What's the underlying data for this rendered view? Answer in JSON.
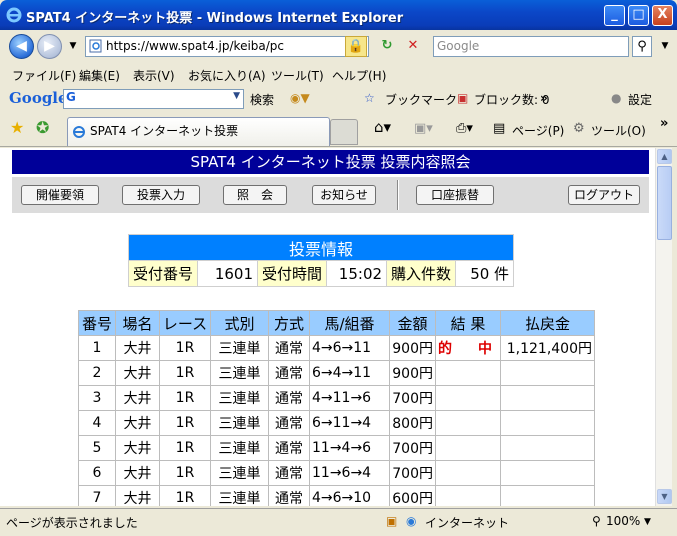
{
  "window": {
    "title": "SPAT4 インターネット投票 - Windows Internet Explorer",
    "minimize": "_",
    "maximize": "□",
    "close": "X"
  },
  "address": {
    "url": "https://www.spat4.jp/keiba/pc",
    "search_placeholder": "Google"
  },
  "menu": [
    "ファイル(F)",
    "編集(E)",
    "表示(V)",
    "お気に入り(A)",
    "ツール(T)",
    "ヘルプ(H)"
  ],
  "google_bar": {
    "logo": "Google",
    "search": "検索",
    "bookmarks": "ブックマーク",
    "blocked": "ブロック数: 0",
    "settings": "設定"
  },
  "tab": {
    "title": "SPAT4 インターネット投票",
    "page": "ページ(P)",
    "tools": "ツール(O)"
  },
  "page": {
    "header": "SPAT4 インターネット投票 投票内容照会",
    "nav": [
      "開催要領",
      "投票入力",
      "照　会",
      "お知らせ",
      "口座振替",
      "ログアウト"
    ],
    "info": {
      "caption": "投票情報",
      "receipt_label": "受付番号",
      "receipt_value": "1601",
      "time_label": "受付時間",
      "time_value": "15:02",
      "count_label": "購入件数",
      "count_value": "50 件"
    },
    "table": {
      "headers": [
        "番号",
        "場名",
        "レース",
        "式別",
        "方式",
        "馬/組番",
        "金額",
        "結 果",
        "払戻金"
      ],
      "rows": [
        [
          "1",
          "大井",
          "1R",
          "三連単",
          "通常",
          "4→6→11",
          "900円",
          "的　中",
          "1,121,400円"
        ],
        [
          "2",
          "大井",
          "1R",
          "三連単",
          "通常",
          "6→4→11",
          "900円",
          "",
          ""
        ],
        [
          "3",
          "大井",
          "1R",
          "三連単",
          "通常",
          "4→11→6",
          "700円",
          "",
          ""
        ],
        [
          "4",
          "大井",
          "1R",
          "三連単",
          "通常",
          "6→11→4",
          "800円",
          "",
          ""
        ],
        [
          "5",
          "大井",
          "1R",
          "三連単",
          "通常",
          "11→4→6",
          "700円",
          "",
          ""
        ],
        [
          "6",
          "大井",
          "1R",
          "三連単",
          "通常",
          "11→6→4",
          "700円",
          "",
          ""
        ],
        [
          "7",
          "大井",
          "1R",
          "三連単",
          "通常",
          "4→6→10",
          "600円",
          "",
          ""
        ]
      ]
    }
  },
  "status": {
    "text": "ページが表示されました",
    "zone": "インターネット",
    "zoom": "100%"
  },
  "colors": {
    "header_bg": "#000099",
    "caption_bg": "#0080ff",
    "th_bg": "#99ccff",
    "label_bg": "#ffffcc",
    "hit": "#dd0000"
  }
}
